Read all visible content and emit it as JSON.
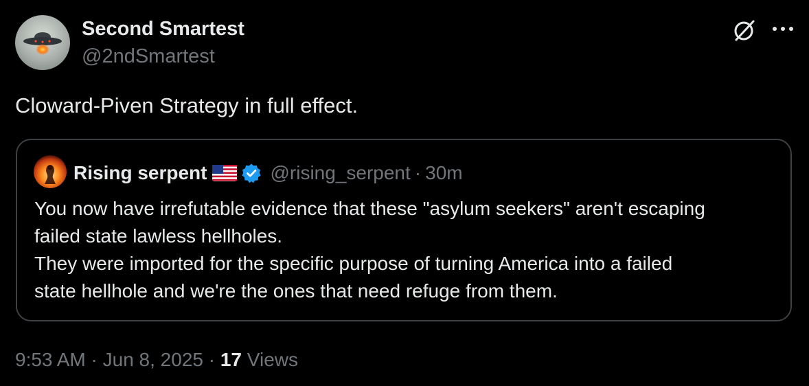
{
  "tweet": {
    "author": {
      "display_name": "Second Smartest",
      "handle": "@2ndSmartest",
      "avatar_icon": "ufo-avatar"
    },
    "actions": {
      "grok_icon": "grok-icon",
      "more_icon": "more-options-icon"
    },
    "text": "Cloward-Piven Strategy in full effect.",
    "quote": {
      "display_name": "Rising serpent",
      "flag_icon": "us-flag-icon",
      "verified_icon": "verified-badge-icon",
      "handle": "@rising_serpent",
      "separator": "·",
      "time": "30m",
      "body_lines": [
        "You now have irrefutable evidence that these \"asylum seekers\" aren't escaping",
        "failed state lawless hellholes.",
        "They were imported for the specific purpose of turning America into a failed",
        "state hellhole and we're the ones that need refuge from them."
      ]
    },
    "meta": {
      "time": "9:53 AM",
      "sep1": "·",
      "date": "Jun 8, 2025",
      "sep2": "·",
      "views_count": "17",
      "views_label": "Views"
    }
  },
  "colors": {
    "background": "#000000",
    "primary_text": "#e7e9ea",
    "secondary_text": "#71767b",
    "border": "#3e4144",
    "verified_blue": "#1d9bf0"
  }
}
